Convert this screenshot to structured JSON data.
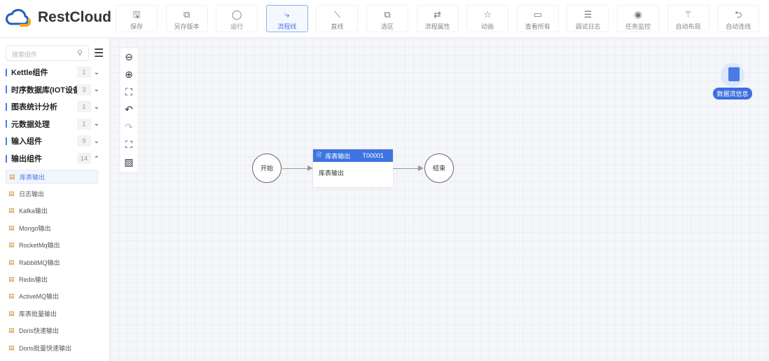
{
  "brand": "RestCloud",
  "toolbar": [
    {
      "label": "保存",
      "icon": "save-icon",
      "glyph": "🖫"
    },
    {
      "label": "另存版本",
      "icon": "copy-icon",
      "glyph": "⧉"
    },
    {
      "label": "运行",
      "icon": "run-icon",
      "glyph": "◯"
    },
    {
      "label": "流程线",
      "icon": "polyline-icon",
      "glyph": "⤷",
      "active": true
    },
    {
      "label": "直线",
      "icon": "line-icon",
      "glyph": "⟍"
    },
    {
      "label": "选区",
      "icon": "select-icon",
      "glyph": "⧉"
    },
    {
      "label": "流程属性",
      "icon": "properties-icon",
      "glyph": "⇄"
    },
    {
      "label": "动画",
      "icon": "star-icon",
      "glyph": "☆"
    },
    {
      "label": "查看所有",
      "icon": "monitor-icon",
      "glyph": "▭"
    },
    {
      "label": "调试日志",
      "icon": "log-icon",
      "glyph": "☰"
    },
    {
      "label": "任务监控",
      "icon": "monitor-camera-icon",
      "glyph": "◉"
    },
    {
      "label": "自动布局",
      "icon": "magic-wand-icon",
      "glyph": "⚚"
    },
    {
      "label": "自动连线",
      "icon": "auto-connect-icon",
      "glyph": "⮌"
    }
  ],
  "sidebar": {
    "search_placeholder": "搜索组件",
    "categories": [
      {
        "label": "Kettle组件",
        "count": "1",
        "expanded": false
      },
      {
        "label": "时序数据库(IOT设备)",
        "count": "3",
        "expanded": false
      },
      {
        "label": "图表统计分析",
        "count": "1",
        "expanded": false
      },
      {
        "label": "元数据处理",
        "count": "1",
        "expanded": false
      },
      {
        "label": "输入组件",
        "count": "9",
        "expanded": false
      },
      {
        "label": "输出组件",
        "count": "14",
        "expanded": true
      }
    ],
    "items": [
      "库表输出",
      "日志输出",
      "Kafka输出",
      "Mongo输出",
      "RocketMq输出",
      "RabbitMQ输出",
      "Redis输出",
      "ActiveMQ输出",
      "库表批量输出",
      "Doris快速输出",
      "Doris批量快速输出"
    ]
  },
  "canvas": {
    "start": "开始",
    "end": "结束",
    "node": {
      "title": "库表输出",
      "id": "T00001",
      "body": "库表输出"
    },
    "info_label": "数据流信息"
  },
  "colors": {
    "accent": "#3d74e0"
  }
}
